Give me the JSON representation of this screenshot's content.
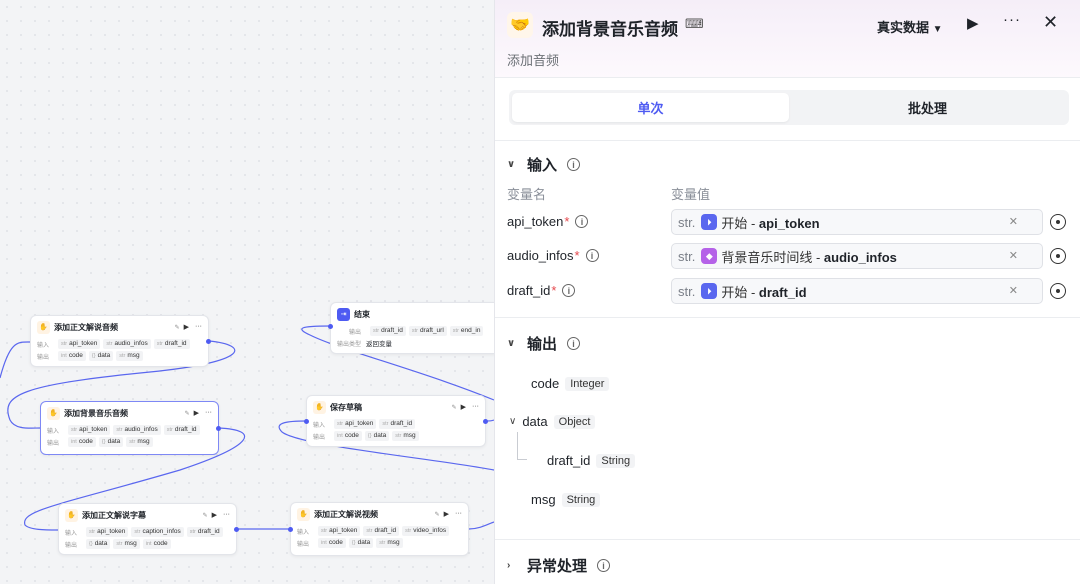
{
  "canvas": {
    "nodes": {
      "n1": {
        "title": "添加正文解说音频",
        "in_label": "输入",
        "out_label": "输出",
        "inputs": [
          {
            "t": "str",
            "v": "api_token"
          },
          {
            "t": "str",
            "v": "audio_infos"
          },
          {
            "t": "str",
            "v": "draft_id"
          }
        ],
        "outputs": [
          {
            "t": "int",
            "v": "code"
          },
          {
            "t": "{}",
            "v": "data"
          },
          {
            "t": "str",
            "v": "msg"
          }
        ]
      },
      "n2": {
        "title": "添加背景音乐音频",
        "in_label": "输入",
        "out_label": "输出",
        "inputs": [
          {
            "t": "str",
            "v": "api_token"
          },
          {
            "t": "str",
            "v": "audio_infos"
          },
          {
            "t": "str",
            "v": "draft_id"
          }
        ],
        "outputs": [
          {
            "t": "int",
            "v": "code"
          },
          {
            "t": "{}",
            "v": "data"
          },
          {
            "t": "str",
            "v": "msg"
          }
        ]
      },
      "n3": {
        "title": "添加正文解说字幕",
        "in_label": "输入",
        "out_label": "输出",
        "inputs": [
          {
            "t": "str",
            "v": "api_token"
          },
          {
            "t": "str",
            "v": "caption_infos"
          },
          {
            "t": "str",
            "v": "draft_id"
          }
        ],
        "outputs": [
          {
            "t": "{}",
            "v": "data"
          },
          {
            "t": "str",
            "v": "msg"
          },
          {
            "t": "int",
            "v": "code"
          }
        ]
      },
      "n4": {
        "title": "结束",
        "in_label": "输出",
        "out_label": "输出类型",
        "inputs": [
          {
            "t": "str",
            "v": "draft_id"
          },
          {
            "t": "str",
            "v": "draft_url"
          },
          {
            "t": "str",
            "v": "end_in"
          }
        ],
        "outputs": [
          {
            "t": "",
            "v": "返回变量"
          }
        ]
      },
      "n5": {
        "title": "保存草稿",
        "in_label": "输入",
        "out_label": "输出",
        "inputs": [
          {
            "t": "str",
            "v": "api_token"
          },
          {
            "t": "str",
            "v": "draft_id"
          }
        ],
        "outputs": [
          {
            "t": "int",
            "v": "code"
          },
          {
            "t": "{}",
            "v": "data"
          },
          {
            "t": "str",
            "v": "msg"
          }
        ]
      },
      "n6": {
        "title": "添加正文解说视频",
        "in_label": "输入",
        "out_label": "输出",
        "inputs": [
          {
            "t": "str",
            "v": "api_token"
          },
          {
            "t": "str",
            "v": "draft_id"
          },
          {
            "t": "str",
            "v": "video_infos"
          }
        ],
        "outputs": [
          {
            "t": "int",
            "v": "code"
          },
          {
            "t": "{}",
            "v": "data"
          },
          {
            "t": "str",
            "v": "msg"
          }
        ]
      }
    }
  },
  "panel": {
    "title": "添加背景音乐音频",
    "description": "添加音频",
    "mode": "真实数据",
    "tabs": [
      "单次",
      "批处理"
    ],
    "input_section": "输入",
    "col_name": "变量名",
    "col_value": "变量值",
    "inputs": [
      {
        "name": "api_token",
        "type": "str.",
        "source": "开始",
        "var": "api_token"
      },
      {
        "name": "audio_infos",
        "type": "str.",
        "source": "背景音乐时间线",
        "var": "audio_infos"
      },
      {
        "name": "draft_id",
        "type": "str.",
        "source": "开始",
        "var": "draft_id"
      }
    ],
    "output_section": "输出",
    "outputs": [
      {
        "name": "code",
        "type": "Integer"
      },
      {
        "name": "data",
        "type": "Object"
      },
      {
        "name": "draft_id",
        "type": "String"
      },
      {
        "name": "msg",
        "type": "String"
      }
    ],
    "exception_section": "异常处理"
  }
}
